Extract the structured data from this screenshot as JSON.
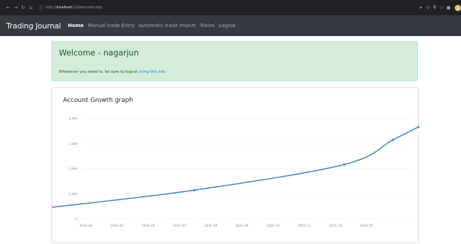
{
  "browser": {
    "url_host": "localhost",
    "url_path": "/12/welcome.php",
    "url_prefix": "http://"
  },
  "navbar": {
    "brand": "Trading Journal",
    "links": [
      "Home",
      "Manual trade Entry",
      "Automatic trade import",
      "Tables",
      "Logout"
    ]
  },
  "alert": {
    "heading": "Welcome - nagarjun",
    "text": "Whenever you need to, be sure to logout ",
    "link_text": "using this link."
  },
  "graph": {
    "title": "Account Growth graph"
  },
  "colors": {
    "navbar_bg": "#343a40",
    "alert_bg": "#d4edda",
    "line": "#4a86c5"
  },
  "chart_data": {
    "type": "line",
    "x": [
      "2021-04",
      "2021-05",
      "2021-06",
      "2021-07",
      "2021-08",
      "2021-09",
      "2021-10",
      "2021-11",
      "2021-12",
      "2022-01"
    ],
    "ylim": [
      0,
      4000
    ],
    "yticks": [
      "0",
      "1,000",
      "2,000",
      "3,000",
      "4,000"
    ],
    "grid": true,
    "series": [
      {
        "points": [
          {
            "x": 2021.13,
            "y": 420
          },
          {
            "x": 2021.54,
            "y": 1150
          },
          {
            "x": 2021.94,
            "y": 2170
          },
          {
            "x": 2022.07,
            "y": 3150
          },
          {
            "x": 2022.14,
            "y": 3680
          }
        ]
      }
    ]
  }
}
